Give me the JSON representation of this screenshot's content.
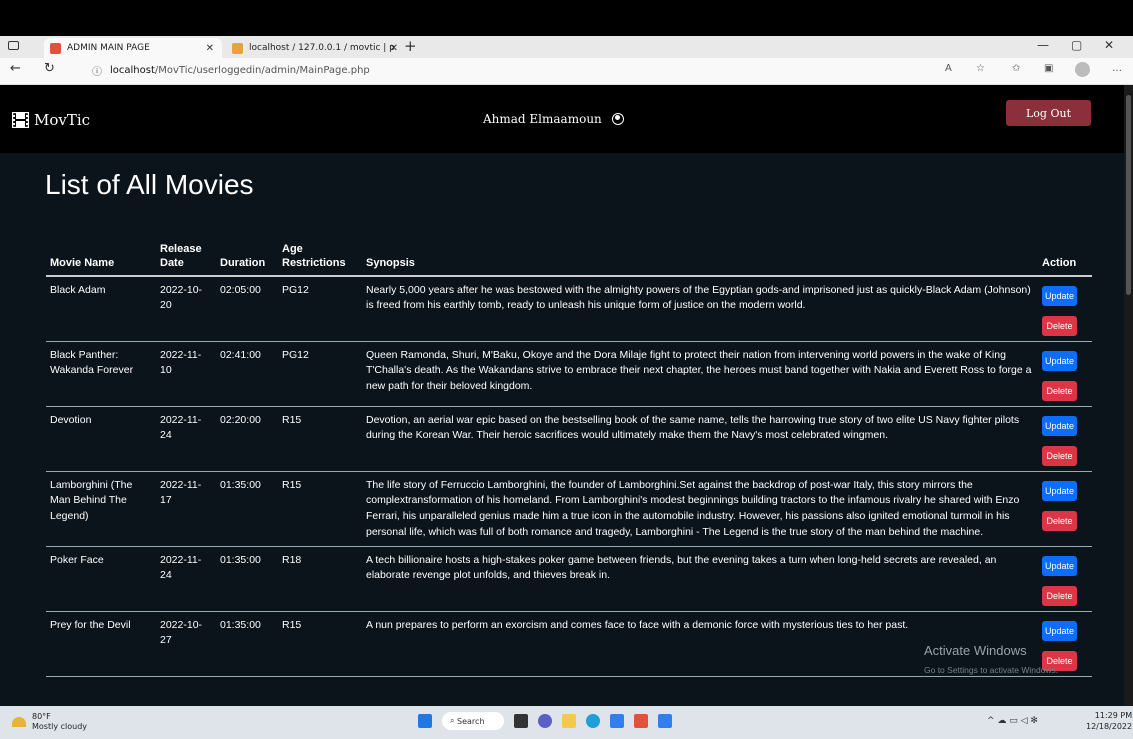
{
  "browser": {
    "tabs": [
      {
        "title": "ADMIN MAIN PAGE",
        "active": true
      },
      {
        "title": "localhost / 127.0.0.1 / movtic | p",
        "active": false
      }
    ],
    "url_host": "localhost",
    "url_path": "/MovTic/userloggedin/admin/MainPage.php"
  },
  "app": {
    "brand": "MovTic",
    "user_name": "Ahmad Elmaamoun",
    "logout_label": "Log Out"
  },
  "page": {
    "title": "List of All Movies",
    "columns": [
      "Movie Name",
      "Release Date",
      "Duration",
      "Age Restrictions",
      "Synopsis",
      "Action"
    ]
  },
  "movies": [
    {
      "name": "Black Adam",
      "release": "2022-10-20",
      "duration": "02:05:00",
      "age": "PG12",
      "synopsis": "Nearly 5,000 years after he was bestowed with the almighty powers of the Egyptian gods-and imprisoned just as quickly-Black Adam (Johnson) is freed from his earthly tomb, ready to unleash his unique form of justice on the modern world."
    },
    {
      "name": "Black Panther: Wakanda Forever",
      "release": "2022-11-10",
      "duration": "02:41:00",
      "age": "PG12",
      "synopsis": "Queen Ramonda, Shuri, M'Baku, Okoye and the Dora Milaje fight to protect their nation from intervening world powers in the wake of King T'Challa's death. As the Wakandans strive to embrace their next chapter, the heroes must band together with Nakia and Everett Ross to forge a new path for their beloved kingdom."
    },
    {
      "name": "Devotion",
      "release": "2022-11-24",
      "duration": "02:20:00",
      "age": "R15",
      "synopsis": "Devotion, an aerial war epic based on the bestselling book of the same name, tells the harrowing true story of two elite US Navy fighter pilots during the Korean War. Their heroic sacrifices would ultimately make them the Navy's most celebrated wingmen."
    },
    {
      "name": "Lamborghini (The Man Behind The Legend)",
      "release": "2022-11-17",
      "duration": "01:35:00",
      "age": "R15",
      "synopsis": "The life story of Ferruccio Lamborghini, the founder of Lamborghini.Set against the backdrop of post-war Italy, this story mirrors the complextransformation of his homeland. From Lamborghini's modest beginnings building tractors to the infamous rivalry he shared with Enzo Ferrari, his unparalleled genius made him a true icon in the automobile industry. However, his passions also ignited emotional turmoil in his personal life, which was full of both romance and tragedy, Lamborghini - The Legend is the true story of the man behind the machine."
    },
    {
      "name": "Poker Face",
      "release": "2022-11-24",
      "duration": "01:35:00",
      "age": "R18",
      "synopsis": "A tech billionaire hosts a high-stakes poker game between friends, but the evening takes a turn when long-held secrets are revealed, an elaborate revenge plot unfolds, and thieves break in."
    },
    {
      "name": "Prey for the Devil",
      "release": "2022-10-27",
      "duration": "01:35:00",
      "age": "R15",
      "synopsis": "A nun prepares to perform an exorcism and comes face to face with a demonic force with mysterious ties to her past."
    }
  ],
  "actions": {
    "update": "Update",
    "delete": "Delete"
  },
  "watermark": {
    "title": "Activate Windows",
    "subtitle": "Go to Settings to activate Windows."
  },
  "taskbar": {
    "temperature": "80°F",
    "weather": "Mostly cloudy",
    "search": "Search",
    "time": "11:29 PM",
    "date": "12/18/2022"
  }
}
